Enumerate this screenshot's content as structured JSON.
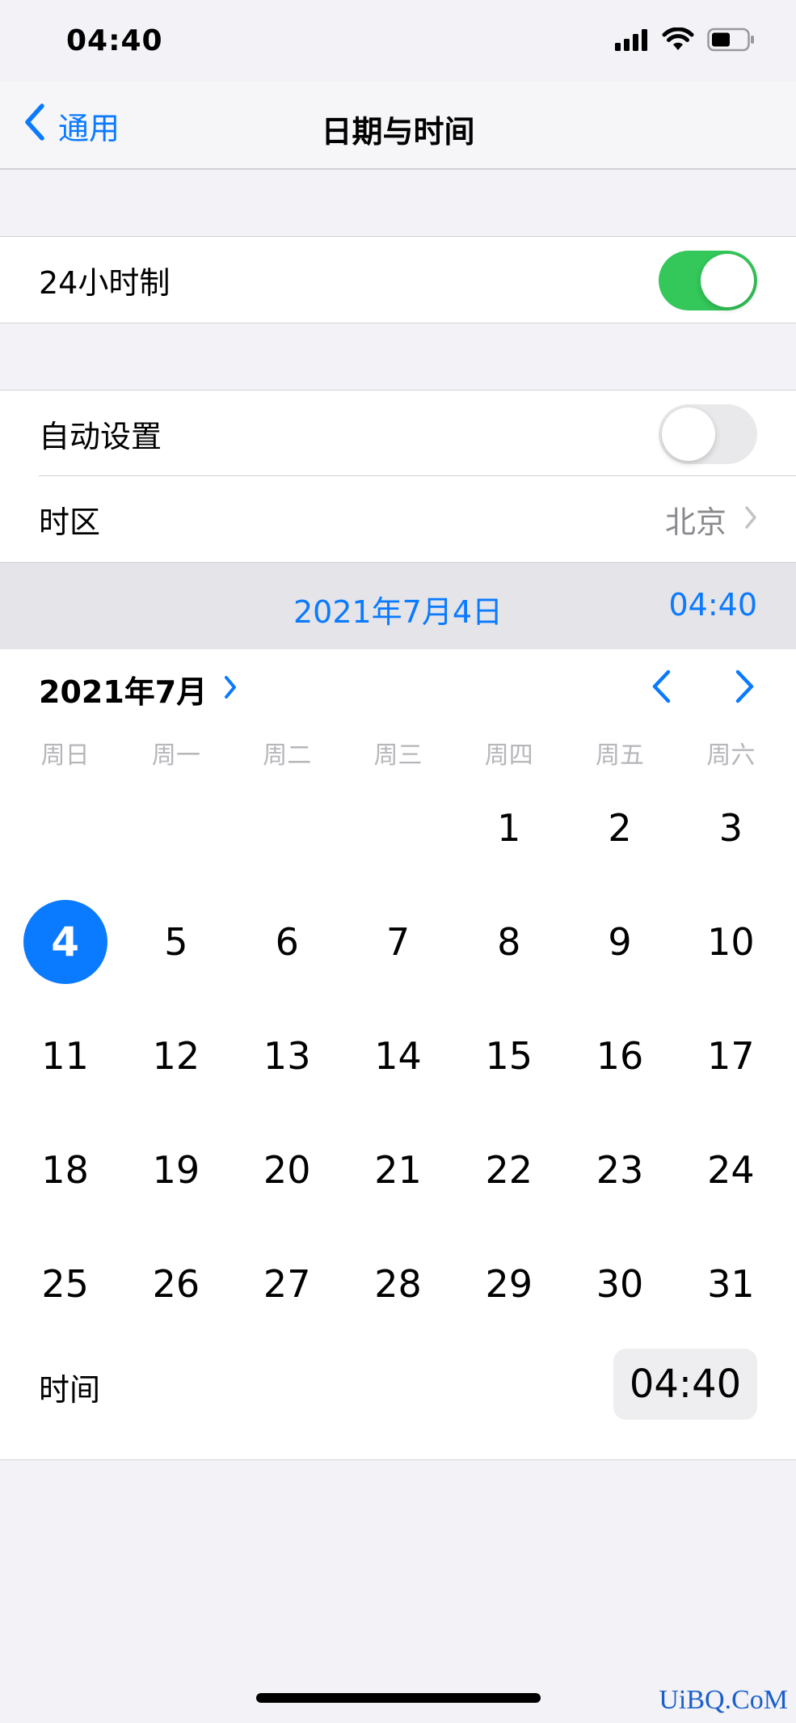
{
  "status_bar": {
    "time": "04:40"
  },
  "nav": {
    "back_label": "通用",
    "title": "日期与时间"
  },
  "settings": {
    "hour24": {
      "label": "24小时制",
      "toggle_on": true
    },
    "auto_set": {
      "label": "自动设置",
      "toggle_on": false
    },
    "timezone": {
      "label": "时区",
      "value": "北京"
    }
  },
  "date_bar": {
    "date": "2021年7月4日",
    "time": "04:40"
  },
  "calendar": {
    "month_title": "2021年7月",
    "weekdays": [
      "周日",
      "周一",
      "周二",
      "周三",
      "周四",
      "周五",
      "周六"
    ],
    "days": [
      "",
      "",
      "",
      "",
      "1",
      "2",
      "3",
      "4",
      "5",
      "6",
      "7",
      "8",
      "9",
      "10",
      "11",
      "12",
      "13",
      "14",
      "15",
      "16",
      "17",
      "18",
      "19",
      "20",
      "21",
      "22",
      "23",
      "24",
      "25",
      "26",
      "27",
      "28",
      "29",
      "30",
      "31"
    ],
    "selected_day": "4"
  },
  "time_row": {
    "label": "时间",
    "value": "04:40"
  },
  "watermark": "UiBQ.CoM",
  "colors": {
    "accent": "#0A7AFF",
    "toggle_on": "#34C759",
    "toggle_off": "#E9E9EB",
    "background": "#F2F2F7"
  }
}
